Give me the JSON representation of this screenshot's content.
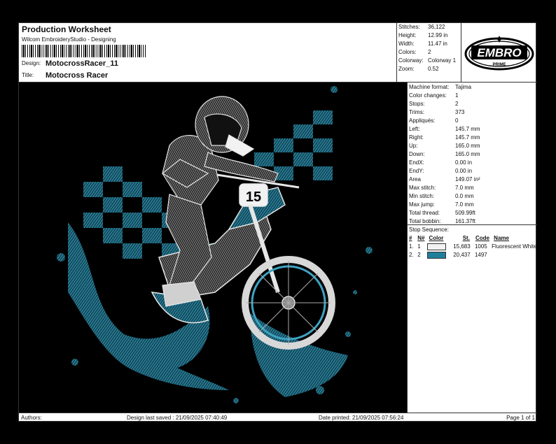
{
  "header": {
    "title": "Production Worksheet",
    "subtitle": "Wilcom EmbroideryStudio - Designing",
    "design_label": "Design:",
    "design_value": "MotocrossRacer_11",
    "title_label": "Title:",
    "title_value": "Motocross Racer"
  },
  "stats": [
    {
      "k": "Stitches:",
      "v": "36,122"
    },
    {
      "k": "Height:",
      "v": "12.99 in"
    },
    {
      "k": "Width:",
      "v": "11.47 in"
    },
    {
      "k": "Colors:",
      "v": "2"
    },
    {
      "k": "Colorway:",
      "v": "Colorway 1"
    },
    {
      "k": "Zoom:",
      "v": "0.52"
    }
  ],
  "logo": {
    "text": "EMBRO",
    "sub": "PRIME"
  },
  "properties": [
    {
      "k": "Machine format:",
      "v": "Tajima"
    },
    {
      "k": "Color changes:",
      "v": "1"
    },
    {
      "k": "Stops:",
      "v": "2"
    },
    {
      "k": "Trims:",
      "v": "373"
    },
    {
      "k": "Appliqués:",
      "v": "0"
    },
    {
      "k": "Left:",
      "v": "145.7 mm"
    },
    {
      "k": "Right:",
      "v": "145.7 mm"
    },
    {
      "k": "Up:",
      "v": "165.0 mm"
    },
    {
      "k": "Down:",
      "v": "165.0 mm"
    },
    {
      "k": "EndX:",
      "v": "0.00 in"
    },
    {
      "k": "EndY:",
      "v": "0.00 in"
    },
    {
      "k": "Area",
      "v": "149.07 in²"
    },
    {
      "k": "Max stitch:",
      "v": "7.0 mm"
    },
    {
      "k": "Min stitch:",
      "v": "0.0 mm"
    },
    {
      "k": "Max jump:",
      "v": "7.0 mm"
    },
    {
      "k": "Total thread:",
      "v": "509.99ft"
    },
    {
      "k": "Total bobbin:",
      "v": "161.37ft"
    }
  ],
  "stop_sequence": {
    "title": "Stop Sequence:",
    "headers": [
      "#",
      "N#",
      "Color",
      "St.",
      "Code",
      "Name"
    ],
    "rows": [
      {
        "num": "1.",
        "n": "1",
        "color": "#f2f2f2",
        "st": "15,683",
        "code": "1005",
        "name": "Fluorescent White"
      },
      {
        "num": "2.",
        "n": "2",
        "color": "#1f7f9a",
        "st": "20,437",
        "code": "1497",
        "name": ""
      }
    ]
  },
  "design": {
    "number_plate": "15"
  },
  "footer": {
    "authors": "Authors:",
    "saved": "Design last saved : 21/09/2025 07:40:49",
    "printed": "Date printed: 21/09/2025 07:56:24",
    "page": "Page 1 of 1"
  }
}
